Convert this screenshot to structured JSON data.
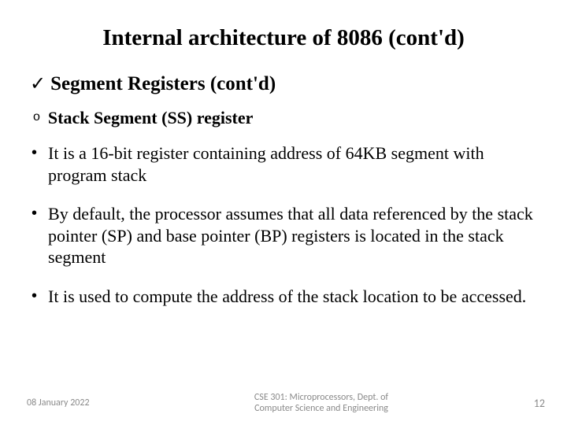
{
  "title": "Internal architecture of 8086 (cont'd)",
  "subheading": "Segment Registers (cont'd)",
  "subsubheading": "Stack Segment (SS) register",
  "bullets": [
    "It is a 16-bit register containing address of 64KB segment with program stack",
    "By default, the processor assumes that all data referenced by the stack pointer (SP) and base pointer (BP) registers is located in the stack segment",
    "It is used to compute the address of the stack location to be accessed."
  ],
  "footer": {
    "date": "08 January 2022",
    "center_line1": "CSE 301: Microprocessors, Dept. of",
    "center_line2": "Computer Science and Engineering",
    "page": "12"
  }
}
